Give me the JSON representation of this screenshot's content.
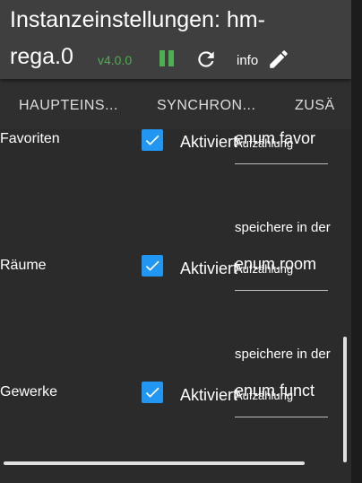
{
  "header": {
    "title_line1": "Instanzeinstellungen: hm-",
    "title_line2": "rega.0",
    "version": "v4.0.0",
    "info_label": "info",
    "accent_color": "#4caf50"
  },
  "tabs": [
    {
      "label": "HAUPTEINS..."
    },
    {
      "label": "SYNCHRON..."
    },
    {
      "label": "ZUSÄ"
    }
  ],
  "rows": [
    {
      "label": "Favoriten",
      "checkbox_label": "Aktiviert",
      "checked": true,
      "field_label": "",
      "field_label_overlap": "Aufzählung",
      "field_value": "enum.favor"
    },
    {
      "label": "Räume",
      "checkbox_label": "Aktiviert",
      "checked": true,
      "field_label": "speichere in der",
      "field_label_overlap": "Aufzählung",
      "field_value": "enum.room"
    },
    {
      "label": "Gewerke",
      "checkbox_label": "Aktiviert",
      "checked": true,
      "field_label": "speichere in der",
      "field_label_overlap": "Aufzählung",
      "field_value": "enum.funct"
    }
  ]
}
